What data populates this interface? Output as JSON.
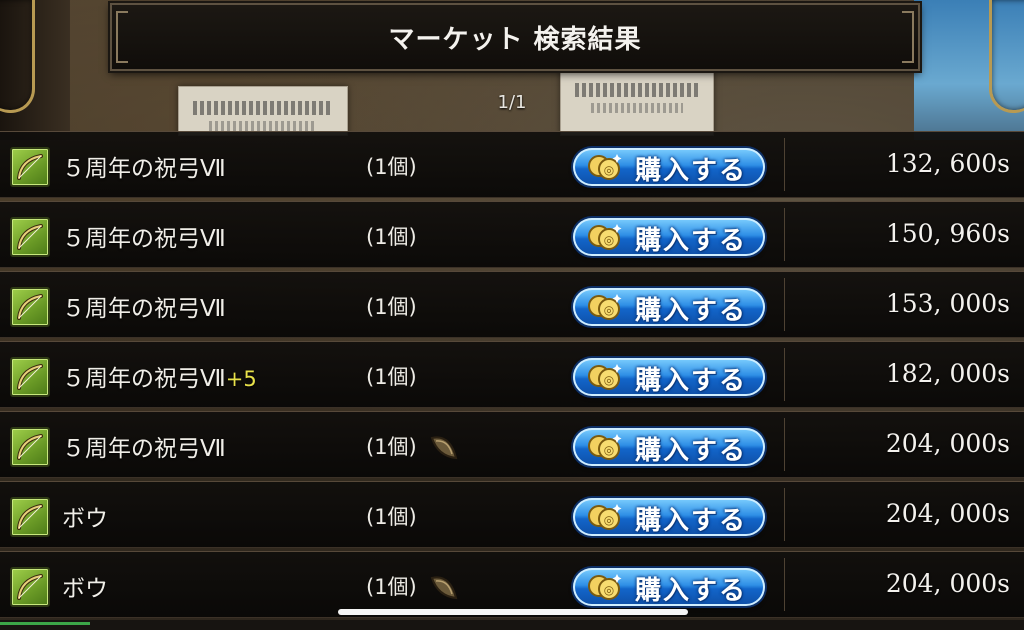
{
  "title": "マーケット  検索結果",
  "page_indicator": "1/1",
  "buy_label": "購入する",
  "rows": [
    {
      "name": "５周年の祝弓Ⅶ",
      "plus": "",
      "qty": "(1個)",
      "seed": false,
      "price": "132, 600s"
    },
    {
      "name": "５周年の祝弓Ⅶ",
      "plus": "",
      "qty": "(1個)",
      "seed": false,
      "price": "150, 960s"
    },
    {
      "name": "５周年の祝弓Ⅶ",
      "plus": "",
      "qty": "(1個)",
      "seed": false,
      "price": "153, 000s"
    },
    {
      "name": "５周年の祝弓Ⅶ",
      "plus": "+5",
      "qty": "(1個)",
      "seed": false,
      "price": "182, 000s"
    },
    {
      "name": "５周年の祝弓Ⅶ",
      "plus": "",
      "qty": "(1個)",
      "seed": true,
      "price": "204, 000s"
    },
    {
      "name": "ボウ",
      "plus": "",
      "qty": "(1個)",
      "seed": false,
      "price": "204, 000s"
    },
    {
      "name": "ボウ",
      "plus": "",
      "qty": "(1個)",
      "seed": true,
      "price": "204, 000s"
    }
  ],
  "icons": {
    "item": "bow-icon",
    "seed": "seed-icon",
    "coin": "coin-icon"
  },
  "colors": {
    "button": "#1f7fe0",
    "plus_text": "#e9e24a",
    "item_icon_bg": "#8ab83c"
  }
}
